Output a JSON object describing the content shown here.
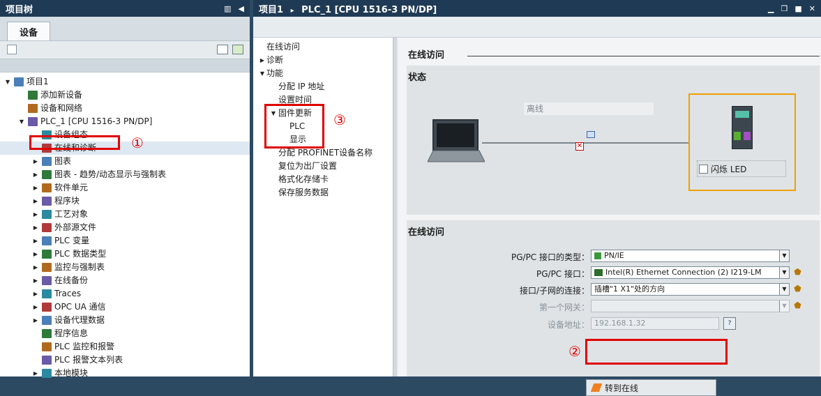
{
  "left_panel": {
    "title": "项目树",
    "tab": "设备"
  },
  "tree": [
    {
      "label": "项目1",
      "icon": "project-icon",
      "level": 0,
      "arrow": "down"
    },
    {
      "label": "添加新设备",
      "icon": "add-device-icon",
      "level": 1,
      "arrow": ""
    },
    {
      "label": "设备和网络",
      "icon": "network-icon",
      "level": 1,
      "arrow": ""
    },
    {
      "label": "PLC_1 [CPU 1516-3 PN/DP]",
      "icon": "plc-icon",
      "level": 1,
      "arrow": "down"
    },
    {
      "label": "设备组态",
      "icon": "device-config-icon",
      "level": 2,
      "arrow": ""
    },
    {
      "label": "在线和诊断",
      "icon": "online-diagnostics-icon",
      "level": 2,
      "arrow": "",
      "selected": true
    },
    {
      "label": "图表",
      "icon": "chart-icon",
      "level": 2,
      "arrow": "right"
    },
    {
      "label": "图表 - 趋势/动态显示与强制表",
      "icon": "trend-icon",
      "level": 2,
      "arrow": "right"
    },
    {
      "label": "软件单元",
      "icon": "software-unit-icon",
      "level": 2,
      "arrow": "right"
    },
    {
      "label": "程序块",
      "icon": "program-block-icon",
      "level": 2,
      "arrow": "right"
    },
    {
      "label": "工艺对象",
      "icon": "technology-object-icon",
      "level": 2,
      "arrow": "right"
    },
    {
      "label": "外部源文件",
      "icon": "external-source-icon",
      "level": 2,
      "arrow": "right"
    },
    {
      "label": "PLC 变量",
      "icon": "plc-tag-icon",
      "level": 2,
      "arrow": "right"
    },
    {
      "label": "PLC 数据类型",
      "icon": "plc-datatype-icon",
      "level": 2,
      "arrow": "right"
    },
    {
      "label": "监控与强制表",
      "icon": "watch-table-icon",
      "level": 2,
      "arrow": "right"
    },
    {
      "label": "在线备份",
      "icon": "online-backup-icon",
      "level": 2,
      "arrow": "right"
    },
    {
      "label": "Traces",
      "icon": "traces-icon",
      "level": 2,
      "arrow": "right"
    },
    {
      "label": "OPC UA 通信",
      "icon": "opc-ua-icon",
      "level": 2,
      "arrow": "right"
    },
    {
      "label": "设备代理数据",
      "icon": "device-proxy-icon",
      "level": 2,
      "arrow": "right"
    },
    {
      "label": "程序信息",
      "icon": "program-info-icon",
      "level": 2,
      "arrow": ""
    },
    {
      "label": "PLC 监控和报警",
      "icon": "plc-alarm-icon",
      "level": 2,
      "arrow": ""
    },
    {
      "label": "PLC 报警文本列表",
      "icon": "alarm-text-icon",
      "level": 2,
      "arrow": ""
    },
    {
      "label": "本地模块",
      "icon": "local-module-icon",
      "level": 2,
      "arrow": "right"
    }
  ],
  "main": {
    "breadcrumb_project": "项目1",
    "breadcrumb_sep": "▸",
    "breadcrumb_device": "PLC_1 [CPU 1516-3 PN/DP]"
  },
  "nav": [
    {
      "label": "在线访问",
      "indent": 0,
      "arrow": ""
    },
    {
      "label": "诊断",
      "indent": 0,
      "arrow": "right"
    },
    {
      "label": "功能",
      "indent": 0,
      "arrow": "down"
    },
    {
      "label": "分配 IP 地址",
      "indent": 1,
      "arrow": ""
    },
    {
      "label": "设置时间",
      "indent": 1,
      "arrow": ""
    },
    {
      "label": "固件更新",
      "indent": 1,
      "arrow": "down"
    },
    {
      "label": "PLC",
      "indent": 2,
      "arrow": ""
    },
    {
      "label": "显示",
      "indent": 2,
      "arrow": ""
    },
    {
      "label": "分配 PROFINET设备名称",
      "indent": 1,
      "arrow": ""
    },
    {
      "label": "复位为出厂设置",
      "indent": 1,
      "arrow": ""
    },
    {
      "label": "格式化存储卡",
      "indent": 1,
      "arrow": ""
    },
    {
      "label": "保存服务数据",
      "indent": 1,
      "arrow": ""
    }
  ],
  "content": {
    "heading": "在线访问",
    "status_title": "状态",
    "offline_label": "离线",
    "flash_led_label": "闪烁 LED",
    "online_title": "在线访问",
    "fields": {
      "interface_type_label": "PG/PC 接口的类型：",
      "interface_type_value": "PN/IE",
      "interface_label": "PG/PC 接口：",
      "interface_value": "Intel(R) Ethernet Connection (2) I219-LM",
      "connection_label": "接口/子网的连接：",
      "connection_value": "插槽\"1 X1\"处的方向",
      "gateway_label": "第一个网关：",
      "gateway_value": "",
      "address_label": "设备地址：",
      "address_value": "192.168.1.32"
    },
    "go_online_button": "转到在线"
  },
  "annotations": {
    "n1": "①",
    "n2": "②",
    "n3": "③"
  },
  "colors": {
    "title_bar": "#1f3a54",
    "callout": "#e00000",
    "highlight_box": "#f0a000"
  }
}
